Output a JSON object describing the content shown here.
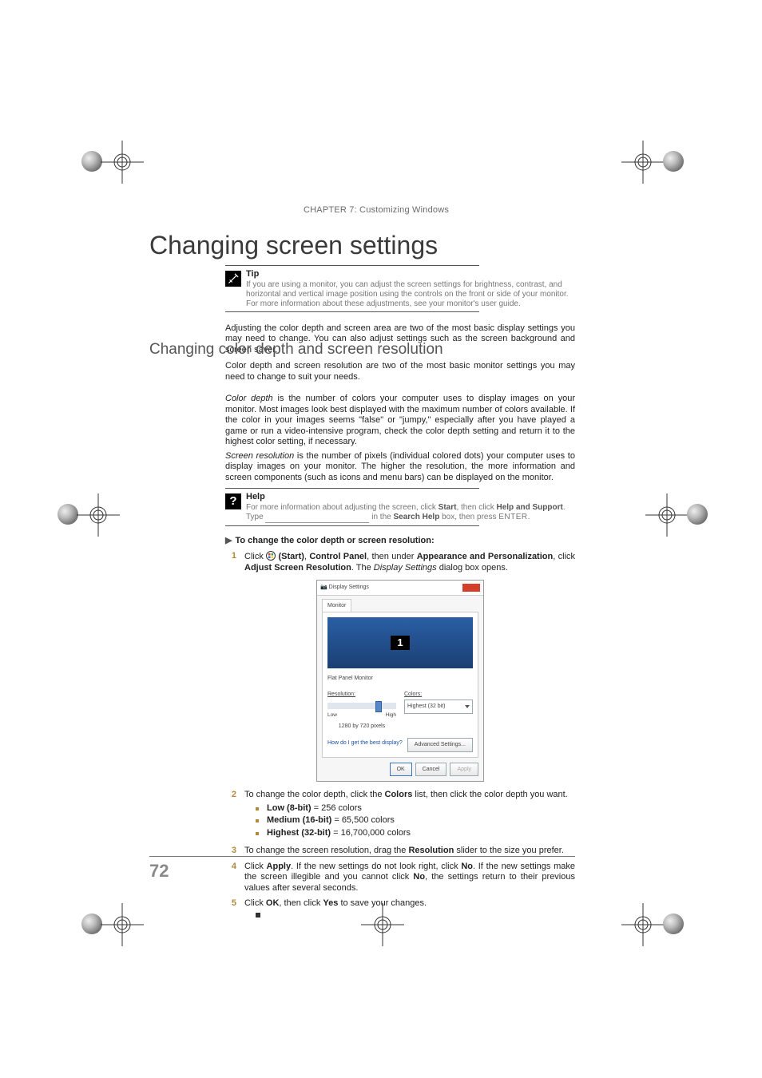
{
  "header": {
    "chapter": "CHAPTER 7: Customizing Windows"
  },
  "h1": "Changing screen settings",
  "tip": {
    "label": "Tip",
    "body": "If you are using a monitor, you can adjust the screen settings for brightness, contrast, and horizontal and vertical image position using the controls on the front or side of your monitor. For more information about these adjustments, see your monitor's user guide."
  },
  "intro": "Adjusting the color depth and screen area are two of the most basic display settings you may need to change. You can also adjust settings such as the screen background and screen saver.",
  "h2": "Changing color depth and screen resolution",
  "p1": "Color depth and screen resolution are two of the most basic monitor settings you may need to change to suit your needs.",
  "p2_prefix": "Color depth",
  "p2": " is the number of colors your computer uses to display images on your monitor. Most images look best displayed with the maximum number of colors available. If the color in your images seems \"false\" or \"jumpy,\" especially after you have played a game or run a video-intensive program, check the color depth setting and return it to the highest color setting, if necessary.",
  "p3_prefix": "Screen resolution",
  "p3": " is the number of pixels (individual colored dots) your computer uses to display images on your monitor. The higher the resolution, the more information and screen components (such as icons and menu bars) can be displayed on the monitor.",
  "help": {
    "label": "Help",
    "a": "For more information about adjusting the screen, click ",
    "b_start": "Start",
    "c": ", then click ",
    "b_hs": "Help and Support",
    "d": ". Type ",
    "e": " in the ",
    "b_sh": "Search Help",
    "f": " box, then press ",
    "enter": "ENTER",
    "g": "."
  },
  "steps_head": "To change the color depth or screen resolution:",
  "step1": {
    "a": "Click ",
    "b_start": " (Start)",
    "c": ", ",
    "b_cp": "Control Panel",
    "d": ", then under ",
    "b_ap": "Appearance and Personalization",
    "e": ", click ",
    "b_asr": "Adjust Screen Resolution",
    "f": ". The ",
    "i_ds": "Display Settings",
    "g": " dialog box opens."
  },
  "dialog": {
    "title": "Display Settings",
    "tab": "Monitor",
    "monitor_num": "1",
    "monitor_name": "Flat Panel Monitor",
    "res_label": "Resolution:",
    "low": "Low",
    "high": "High",
    "res_value": "1280 by 720 pixels",
    "link": "How do I get the best display?",
    "colors_label": "Colors:",
    "colors_value": "Highest (32 bit)",
    "adv": "Advanced Settings...",
    "ok": "OK",
    "cancel": "Cancel",
    "apply": "Apply"
  },
  "step2": {
    "a": "To change the color depth, click the ",
    "b_colors": "Colors",
    "c": " list, then click the color depth you want."
  },
  "sub": {
    "low_l": "Low (8-bit)",
    "low_r": " = 256 colors",
    "med_l": "Medium (16-bit)",
    "med_r": " = 65,500 colors",
    "high_l": "Highest (32-bit)",
    "high_r": " = 16,700,000 colors"
  },
  "step3": {
    "a": "To change the screen resolution, drag the ",
    "b_res": "Resolution",
    "c": " slider to the size you prefer."
  },
  "step4": {
    "a": "Click ",
    "b_apply": "Apply",
    "c": ". If the new settings do not look right, click ",
    "b_no1": "No",
    "d": ". If the new settings make the screen illegible and you cannot click ",
    "b_no2": "No",
    "e": ", the settings return to their previous values after several seconds."
  },
  "step5": {
    "a": "Click ",
    "b_ok": "OK",
    "c": ", then click ",
    "b_yes": "Yes",
    "d": " to save your changes."
  },
  "page_number": "72"
}
